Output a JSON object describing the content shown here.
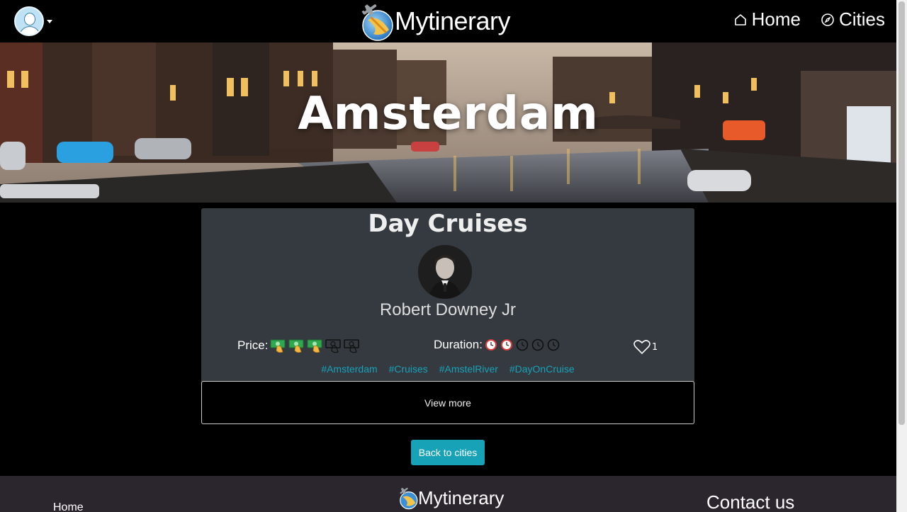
{
  "navbar": {
    "brand": "Mytinerary",
    "links": [
      {
        "label": "Home",
        "icon": "home-icon"
      },
      {
        "label": "Cities",
        "icon": "compass-icon"
      }
    ]
  },
  "hero": {
    "city": "Amsterdam"
  },
  "itinerary": {
    "title": "Day Cruises",
    "author": "Robert Downey Jr",
    "price_label": "Price:",
    "price_level": 3,
    "price_max": 5,
    "duration_label": "Duration:",
    "duration_level": 2,
    "duration_max": 5,
    "likes": "1",
    "hashtags": [
      "#Amsterdam",
      "#Cruises",
      "#AmstelRiver",
      "#DayOnCruise"
    ],
    "view_more_label": "View more"
  },
  "back_button_label": "Back to cities",
  "footer": {
    "home_label": "Home",
    "brand": "Mytinerary",
    "contact_label": "Contact us"
  },
  "colors": {
    "accent": "#17a2b8",
    "card_bg": "#343a40",
    "footer_bg": "#2b262d"
  }
}
